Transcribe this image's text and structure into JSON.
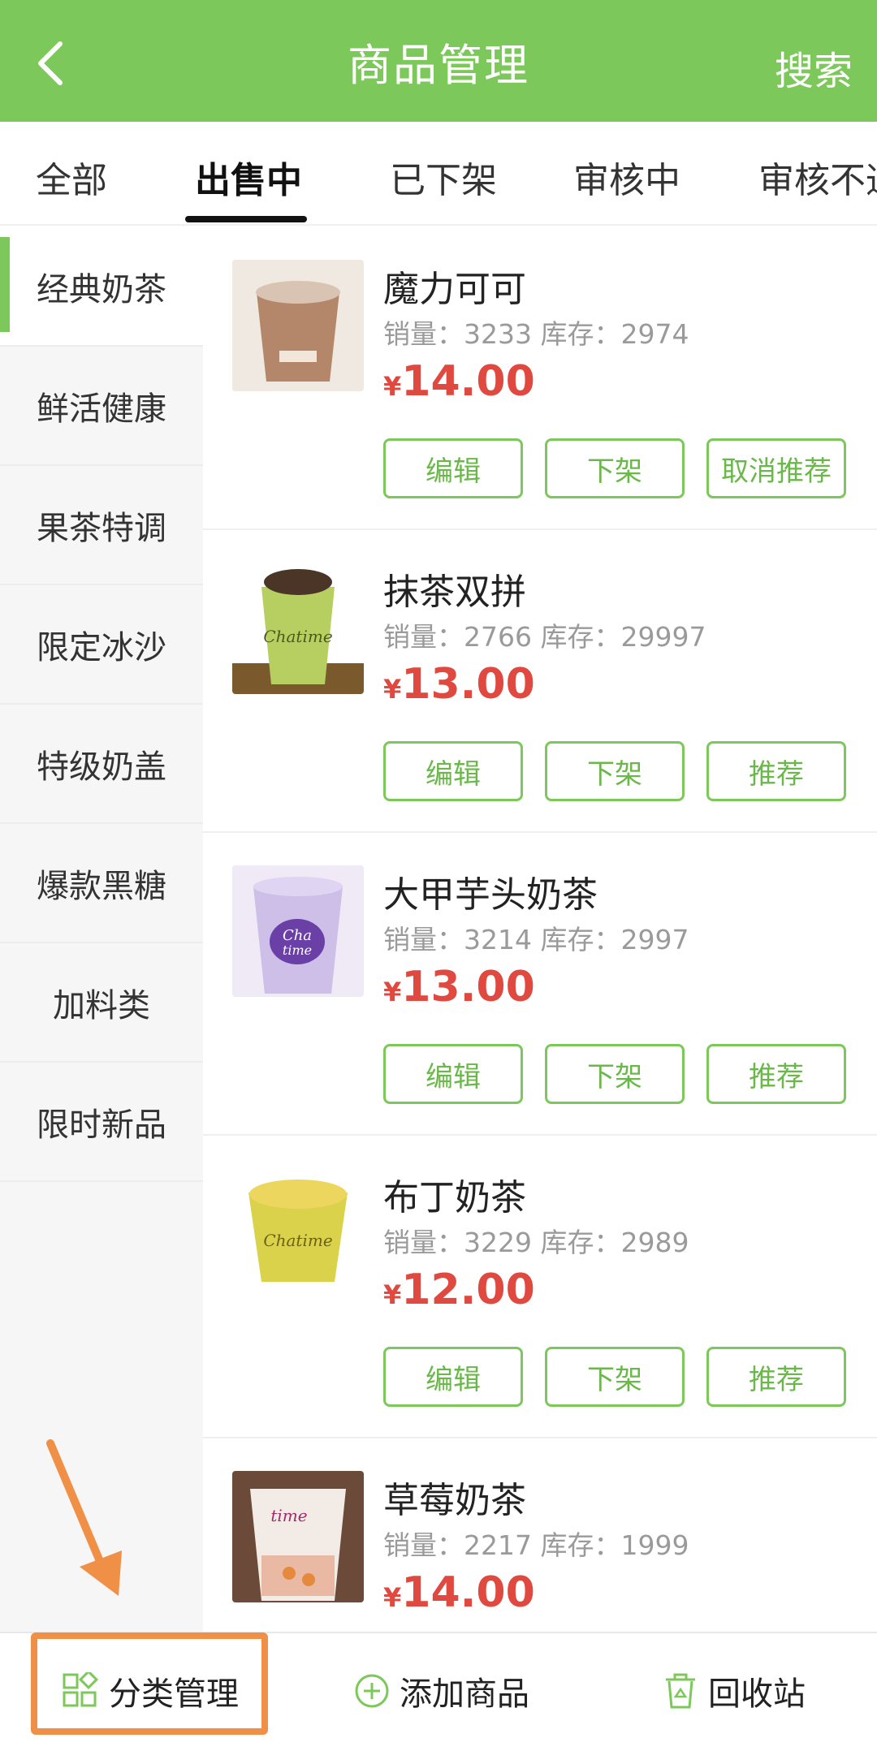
{
  "header": {
    "title": "商品管理",
    "search_label": "搜索"
  },
  "tabs": [
    {
      "label": "全部"
    },
    {
      "label": "出售中"
    },
    {
      "label": "已下架"
    },
    {
      "label": "审核中"
    },
    {
      "label": "审核不通过"
    }
  ],
  "sidebar": {
    "items": [
      {
        "label": "经典奶茶"
      },
      {
        "label": "鲜活健康"
      },
      {
        "label": "果茶特调"
      },
      {
        "label": "限定冰沙"
      },
      {
        "label": "特级奶盖"
      },
      {
        "label": "爆款黑糖"
      },
      {
        "label": "加料类"
      },
      {
        "label": "限时新品"
      }
    ]
  },
  "products": [
    {
      "name": "魔力可可",
      "meta": "销量：3233 库存：2974",
      "currency": "¥",
      "price": "14.00",
      "edit": "编辑",
      "offshelf": "下架",
      "recommend": "取消推荐",
      "cup_color": "#b4876a"
    },
    {
      "name": "抹茶双拼",
      "meta": "销量：2766 库存：29997",
      "currency": "¥",
      "price": "13.00",
      "edit": "编辑",
      "offshelf": "下架",
      "recommend": "推荐",
      "cup_color": "#b7cf60"
    },
    {
      "name": "大甲芋头奶茶",
      "meta": "销量：3214 库存：2997",
      "currency": "¥",
      "price": "13.00",
      "edit": "编辑",
      "offshelf": "下架",
      "recommend": "推荐",
      "cup_color": "#cdbfe8"
    },
    {
      "name": "布丁奶茶",
      "meta": "销量：3229 库存：2989",
      "currency": "¥",
      "price": "12.00",
      "edit": "编辑",
      "offshelf": "下架",
      "recommend": "推荐",
      "cup_color": "#d9d24a"
    },
    {
      "name": "草莓奶茶",
      "meta": "销量：2217 库存：1999",
      "currency": "¥",
      "price": "14.00",
      "cup_color": "#e9b9a4"
    }
  ],
  "bottom_bar": {
    "category": "分类管理",
    "add": "添加商品",
    "recycle": "回收站"
  },
  "colors": {
    "brand": "#7cc85a",
    "price": "#e0493f",
    "highlight": "#f08f46"
  }
}
